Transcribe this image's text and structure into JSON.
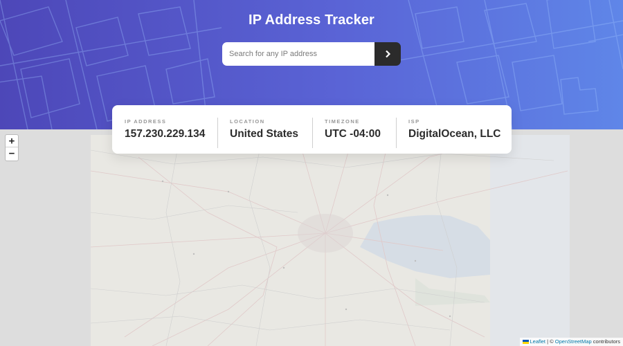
{
  "header": {
    "title": "IP Address Tracker",
    "colors": {
      "gradient_start": "#4d47b8",
      "gradient_end": "#5f86e8"
    }
  },
  "search": {
    "placeholder": "Search for any IP address",
    "value": "",
    "submit_icon": "chevron-right-icon"
  },
  "info": {
    "ip_address": {
      "label": "IP ADDRESS",
      "value": "157.230.229.134"
    },
    "location": {
      "label": "LOCATION",
      "value": "United States"
    },
    "timezone": {
      "label": "TIMEZONE",
      "value": "UTC -04:00"
    },
    "isp": {
      "label": "ISP",
      "value": "DigitalOcean, LLC"
    }
  },
  "map": {
    "zoom_in_label": "+",
    "zoom_out_label": "−",
    "attribution": {
      "leaflet_link": "Leaflet",
      "separator": " | © ",
      "osm_link": "OpenStreetMap",
      "suffix": " contributors"
    }
  }
}
